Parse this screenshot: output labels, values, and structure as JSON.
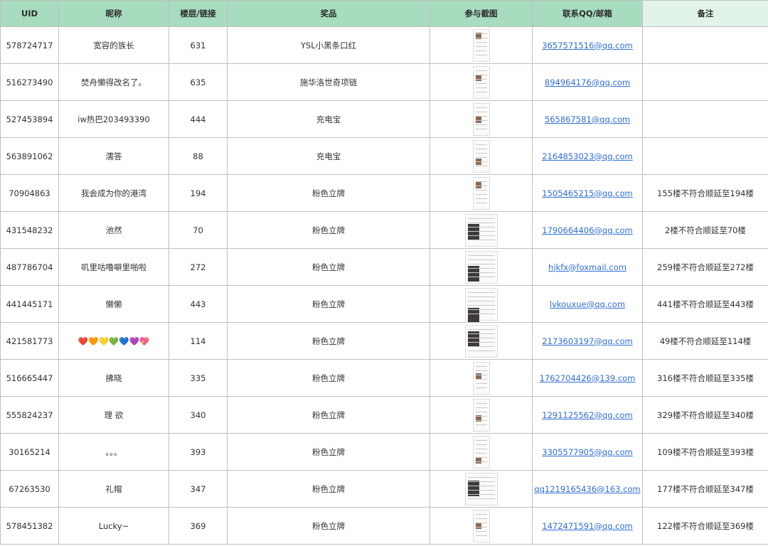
{
  "headers": [
    "UID",
    "昵称",
    "楼层/链接",
    "奖品",
    "参与截图",
    "联系QQ/邮箱",
    "备注"
  ],
  "rows": [
    {
      "uid": "578724717",
      "nickname": "宽容的族长",
      "floor": "631",
      "prize": "YSL小黑条口红",
      "email": "3657571516@qq.com",
      "note": ""
    },
    {
      "uid": "516273490",
      "nickname": "焚舟懒得改名了。",
      "floor": "635",
      "prize": "施华洛世奇项链",
      "email": "894964176@qq.com",
      "note": ""
    },
    {
      "uid": "527453894",
      "nickname": "iw热巴203493390",
      "floor": "444",
      "prize": "充电宝",
      "email": "565867581@qq.com",
      "note": ""
    },
    {
      "uid": "563891062",
      "nickname": "濡答",
      "floor": "88",
      "prize": "充电宝",
      "email": "2164853023@qq.com",
      "note": ""
    },
    {
      "uid": "70904863",
      "nickname": "我会成为你的港湾",
      "floor": "194",
      "prize": "粉色立牌",
      "email": "1505465215@qq.com",
      "note": "155楼不符合顺延至194楼"
    },
    {
      "uid": "431548232",
      "nickname": "池然",
      "floor": "70",
      "prize": "粉色立牌",
      "email": "1790664406@qq.com",
      "note": "2楼不符合顺延至70楼"
    },
    {
      "uid": "487786704",
      "nickname": "叽里咕噜噼里啪啦",
      "floor": "272",
      "prize": "粉色立牌",
      "email": "hjkfx@foxmail.com",
      "note": "259楼不符合顺延至272楼"
    },
    {
      "uid": "441445171",
      "nickname": "懒懒",
      "floor": "443",
      "prize": "粉色立牌",
      "email": "lvkouxue@qq.com",
      "note": "441楼不符合顺延至443楼"
    },
    {
      "uid": "421581773",
      "nickname": "❤️🧡💛💚💙💜💖",
      "floor": "114",
      "prize": "粉色立牌",
      "email": "2173603197@qq.com",
      "note": "49楼不符合顺延至114楼"
    },
    {
      "uid": "516665447",
      "nickname": "拂晓",
      "floor": "335",
      "prize": "粉色立牌",
      "email": "1762704426@139.com",
      "note": "316楼不符合顺延至335楼"
    },
    {
      "uid": "555824237",
      "nickname": "理 欲",
      "floor": "340",
      "prize": "粉色立牌",
      "email": "1291125562@qq.com",
      "note": "329楼不符合顺延至340楼"
    },
    {
      "uid": "30165214",
      "nickname": "。。。",
      "floor": "393",
      "prize": "粉色立牌",
      "email": "3305577905@qq.com",
      "note": "109楼不符合顺延至393楼"
    },
    {
      "uid": "67263530",
      "nickname": "礼帽",
      "floor": "347",
      "prize": "粉色立牌",
      "email": "qq1219165436@163.com",
      "note": "177楼不符合顺延至347楼"
    },
    {
      "uid": "578451382",
      "nickname": "Lucky~",
      "floor": "369",
      "prize": "粉色立牌",
      "email": "1472471591@qq.com",
      "note": "122楼不符合顺延至369楼"
    }
  ],
  "colors": {
    "header_bg": "#a7dcbf",
    "header_last_bg": "#e2f4ea",
    "link": "#2f6fd6",
    "border": "#bfbfbf"
  },
  "icons": {
    "screenshot_column": "screenshot-thumbnail-icon"
  }
}
